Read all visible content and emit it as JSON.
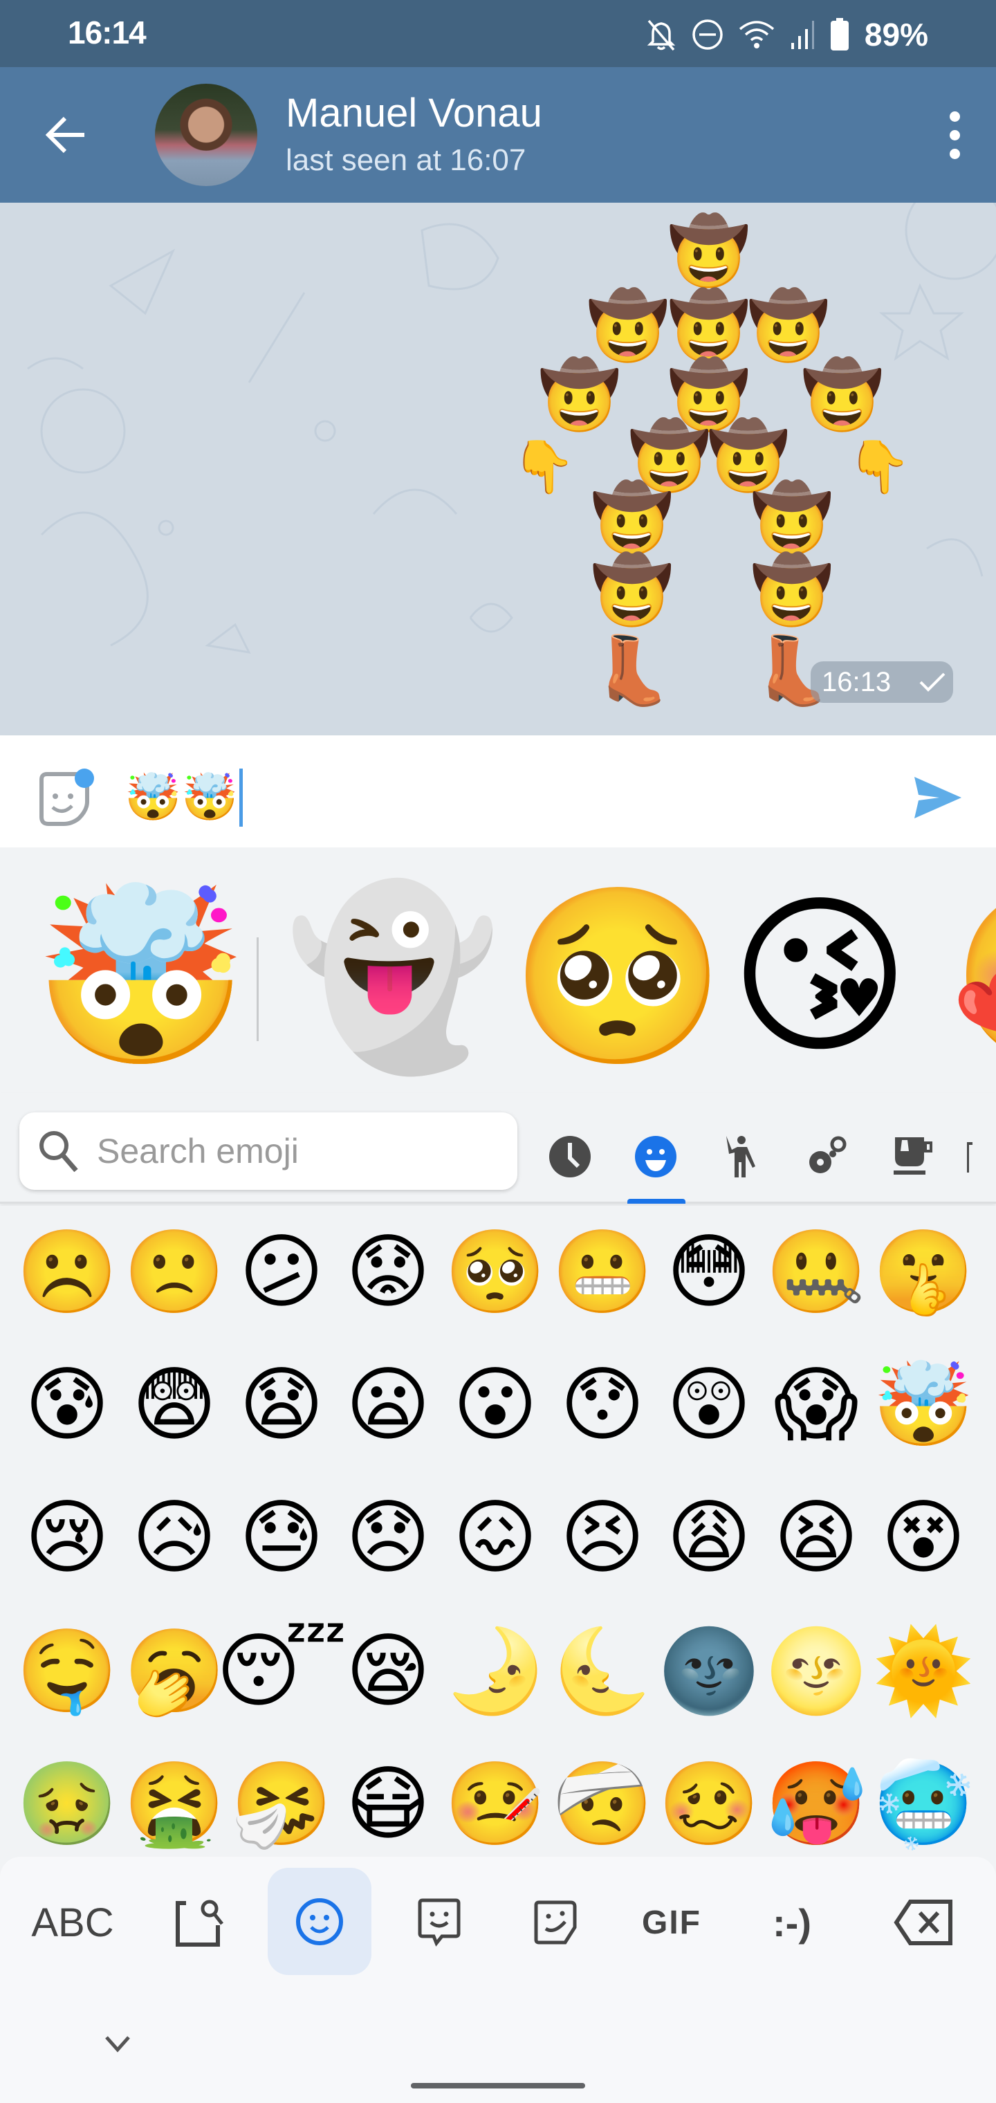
{
  "status_bar": {
    "time": "16:14",
    "icons": [
      "notifications-off-icon",
      "do-not-disturb-icon",
      "wifi-icon",
      "signal-icon",
      "battery-icon"
    ],
    "battery_percent": "89%"
  },
  "header": {
    "contact_name": "Manuel Vonau",
    "contact_status": "last seen at 16:07",
    "back_icon": "arrow-left-icon",
    "menu_icon": "more-vert-icon"
  },
  "chat": {
    "message": {
      "emoji_art": {
        "cowboy": "🤠",
        "pointing_down": "👇",
        "boot": "👢"
      },
      "time": "16:13",
      "status_icon": "check-icon"
    }
  },
  "input": {
    "value": "🤯🤯",
    "sticker_icon": "sticker-icon",
    "send_icon": "send-icon"
  },
  "suggestions": {
    "items": [
      "🤯",
      "👻",
      "🥺",
      "😘",
      "🥰"
    ]
  },
  "emoji_panel": {
    "search_placeholder": "Search emoji",
    "categories": [
      {
        "name": "recent",
        "icon": "clock-icon",
        "active": false
      },
      {
        "name": "smileys",
        "icon": "smiley-icon",
        "active": true
      },
      {
        "name": "people",
        "icon": "person-icon",
        "active": false
      },
      {
        "name": "nature",
        "icon": "flower-icon",
        "active": false
      },
      {
        "name": "food",
        "icon": "cup-icon",
        "active": false
      },
      {
        "name": "travel",
        "icon": "building-icon",
        "active": false
      }
    ],
    "accent_color": "#1a73e8",
    "grid": [
      [
        "☹️",
        "🙁",
        "😕",
        "😟",
        "🥺",
        "😬",
        "😳",
        "🤐",
        "🤫"
      ],
      [
        "😰",
        "😨",
        "😧",
        "😦",
        "😮",
        "😯",
        "😲",
        "😱",
        "🤯"
      ],
      [
        "😢",
        "😥",
        "😓",
        "😞",
        "😖",
        "😣",
        "😩",
        "😫",
        "😵"
      ],
      [
        "🤤",
        "🥱",
        "😴",
        "😪",
        "🌛",
        "🌜",
        "🌚",
        "🌝",
        "🌞"
      ],
      [
        "🤢",
        "🤮",
        "🤧",
        "😷",
        "🤒",
        "🤕",
        "🥴",
        "🥵",
        "🥶"
      ]
    ]
  },
  "keyboard": {
    "abc_label": "ABC",
    "gif_label": "GIF",
    "emoticon_label": ":-)",
    "buttons": [
      "abc",
      "emoji-search",
      "emoji",
      "emoji-kitchen-sticker",
      "sticker",
      "gif",
      "emoticon",
      "backspace"
    ]
  }
}
